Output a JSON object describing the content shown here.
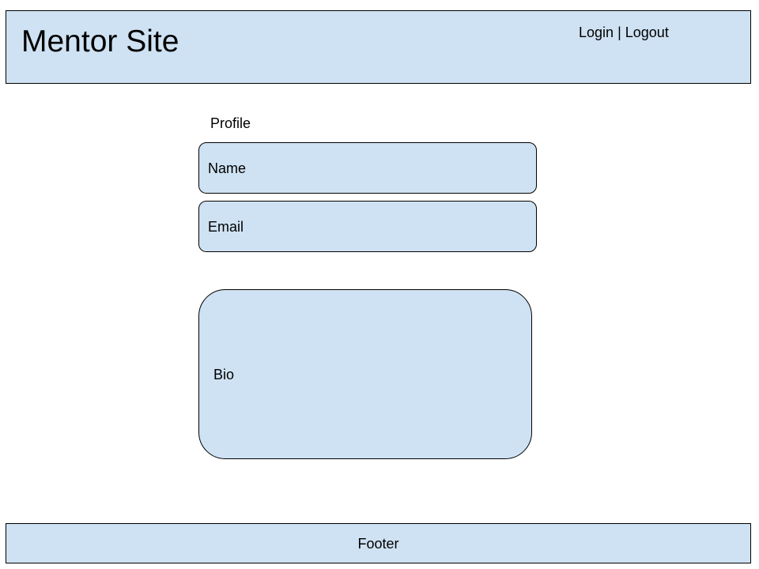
{
  "header": {
    "site_title": "Mentor Site",
    "login_label": "Login",
    "separator": "|",
    "logout_label": "Logout"
  },
  "profile": {
    "heading": "Profile",
    "name_label": "Name",
    "email_label": "Email",
    "bio_label": "Bio"
  },
  "footer": {
    "label": "Footer"
  },
  "colors": {
    "panel_fill": "#cfe2f3",
    "border": "#000000",
    "background": "#ffffff"
  }
}
